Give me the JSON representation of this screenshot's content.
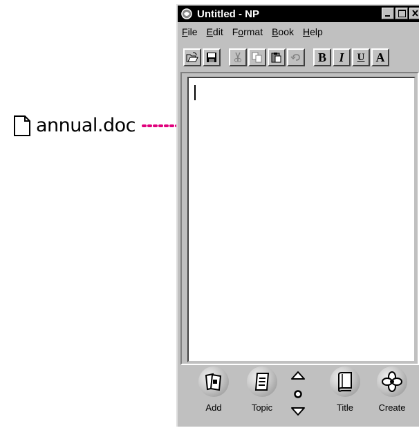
{
  "annotation": {
    "filename": "annual.doc",
    "arrow_color": "#e0007c"
  },
  "window": {
    "title": "Untitled - NP",
    "menu": [
      {
        "label": "File",
        "mnemonic": "F"
      },
      {
        "label": "Edit",
        "mnemonic": "E"
      },
      {
        "label": "Format",
        "mnemonic": "o"
      },
      {
        "label": "Book",
        "mnemonic": "B"
      },
      {
        "label": "Help",
        "mnemonic": "H"
      }
    ],
    "toolbar": {
      "bold": "B",
      "italic": "I",
      "underline": "U",
      "font": "A"
    },
    "bottom_buttons": {
      "add": "Add",
      "topic": "Topic",
      "title": "Title",
      "create": "Create"
    }
  },
  "colors": {
    "accent_arrow": "#e0007c",
    "titlebar": "#000000",
    "chrome": "#c0c0c0"
  }
}
